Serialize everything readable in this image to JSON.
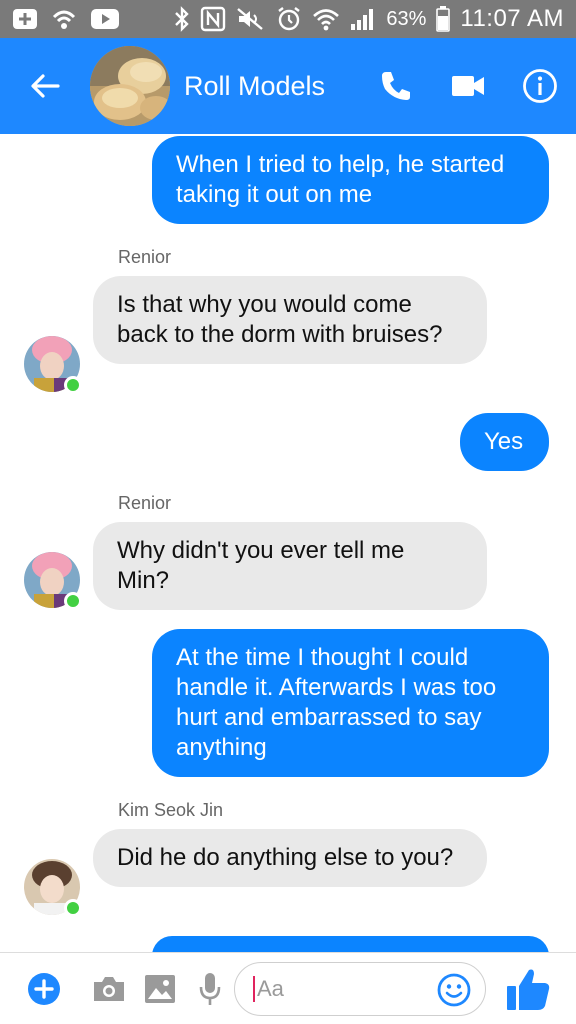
{
  "status_bar": {
    "battery_percent": "63%",
    "time": "11:07 AM",
    "icons": [
      "add-icon",
      "wifi-call-icon",
      "youtube-icon",
      "bluetooth-icon",
      "nfc-icon",
      "mute-icon",
      "alarm-icon",
      "wifi-icon",
      "signal-icon",
      "battery-icon"
    ]
  },
  "header": {
    "title": "Roll Models",
    "icons": [
      "back-arrow-icon",
      "phone-icon",
      "video-camera-icon",
      "info-icon"
    ],
    "accent_color": "#1e88ff"
  },
  "messages": [
    {
      "type": "out",
      "text": "When I tried to help, he started taking it out on me"
    },
    {
      "type": "sender",
      "text": "Renior"
    },
    {
      "type": "in",
      "text": "Is that why you would come back to the dorm with bruises?"
    },
    {
      "type": "out",
      "text": "Yes"
    },
    {
      "type": "sender",
      "text": "Renior"
    },
    {
      "type": "in",
      "text": "Why didn't you ever tell me Min?"
    },
    {
      "type": "out",
      "text": "At the time I thought I could handle it. Afterwards I was too hurt and embarrassed to say anything"
    },
    {
      "type": "sender",
      "text": "Kim Seok Jin"
    },
    {
      "type": "in",
      "text": "Did he do anything else to you?"
    }
  ],
  "composer": {
    "placeholder": "Aa",
    "icons": [
      "plus-icon",
      "camera-icon",
      "gallery-icon",
      "microphone-icon",
      "emoji-icon",
      "thumbs-up-icon"
    ]
  },
  "colors": {
    "outgoing_bubble": "#0b84ff",
    "incoming_bubble": "#e9e9e9",
    "online_dot": "#42d042"
  }
}
